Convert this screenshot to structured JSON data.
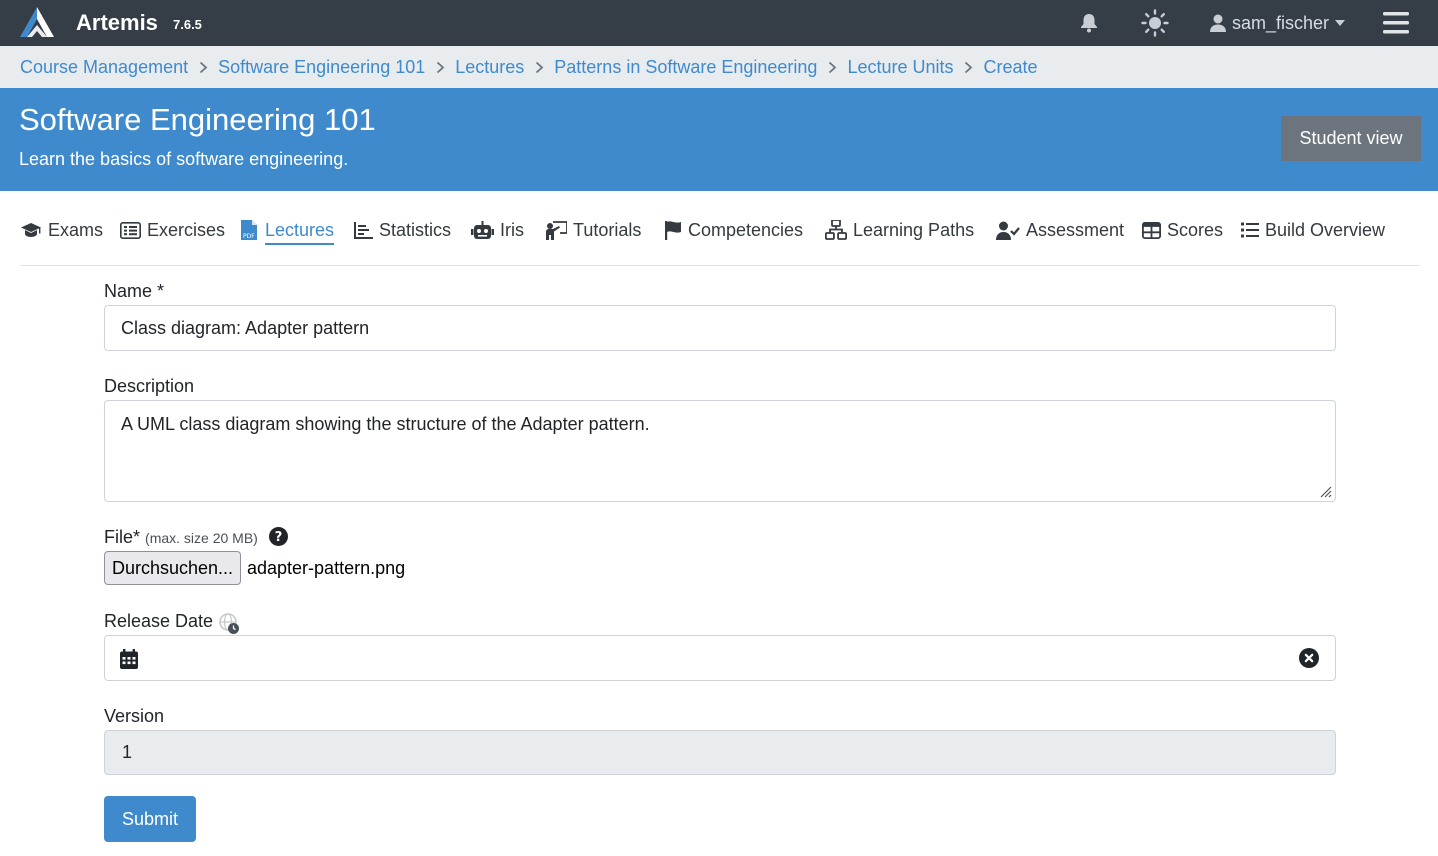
{
  "navbar": {
    "brand": "Artemis",
    "version": "7.6.5",
    "username": "sam_fischer"
  },
  "breadcrumb": [
    "Course Management",
    "Software Engineering 101",
    "Lectures",
    "Patterns in Software Engineering",
    "Lecture Units",
    "Create"
  ],
  "course": {
    "title": "Software Engineering 101",
    "description": "Learn the basics of software engineering.",
    "student_view_label": "Student view"
  },
  "tabs": [
    {
      "label": "Exams",
      "icon": "graduation-cap-icon"
    },
    {
      "label": "Exercises",
      "icon": "list-alt-icon"
    },
    {
      "label": "Lectures",
      "icon": "file-pdf-icon",
      "active": true
    },
    {
      "label": "Statistics",
      "icon": "chart-icon"
    },
    {
      "label": "Iris",
      "icon": "robot-icon"
    },
    {
      "label": "Tutorials",
      "icon": "chalkboard-teacher-icon"
    },
    {
      "label": "Competencies",
      "icon": "flag-icon"
    },
    {
      "label": "Learning Paths",
      "icon": "network-icon"
    },
    {
      "label": "Assessment",
      "icon": "user-check-icon"
    },
    {
      "label": "Scores",
      "icon": "table-icon"
    },
    {
      "label": "Build Overview",
      "icon": "list-icon"
    }
  ],
  "form": {
    "name_label": "Name *",
    "name_value": "Class diagram: Adapter pattern",
    "description_label": "Description",
    "description_value": "A UML class diagram showing the structure of the Adapter pattern.",
    "file_label": "File*",
    "file_hint": "(max. size 20 MB)",
    "file_button_label": "Durchsuchen...",
    "file_name": "adapter-pattern.png",
    "release_date_label": "Release Date",
    "release_date_value": "",
    "version_label": "Version",
    "version_value": "1",
    "submit_label": "Submit"
  },
  "colors": {
    "navbar": "#353d47",
    "primary": "#3e8acc",
    "breadcrumb_bg": "#e9ecef",
    "secondary_button": "#6c757d"
  }
}
